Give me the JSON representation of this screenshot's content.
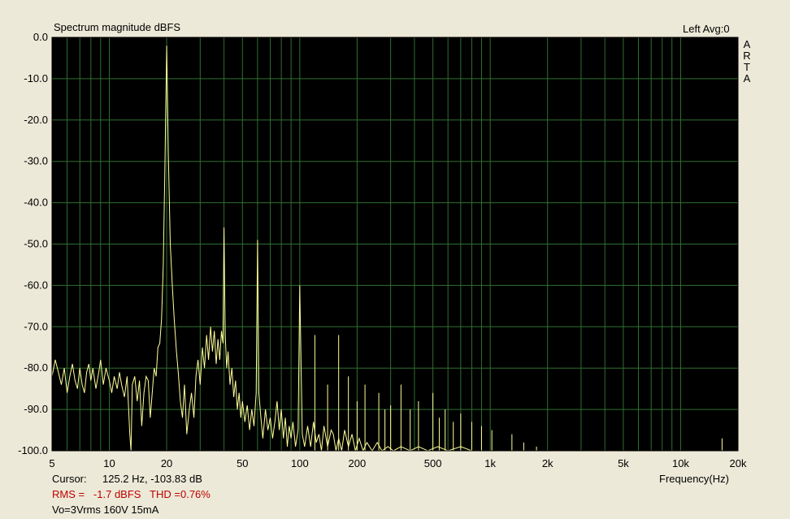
{
  "header": {
    "title": "Spectrum magnitude dBFS",
    "channel_info": "Left  Avg:0",
    "brand_letters": [
      "A",
      "R",
      "T",
      "A"
    ]
  },
  "footer": {
    "cursor_label": "Cursor:",
    "cursor_value": "125.2 Hz, -103.83 dB",
    "rms_text": "RMS =   -1.7 dBFS   THD =0.76%",
    "note": "Vo=3Vrms 160V 15mA"
  },
  "colors": {
    "background": "#ece9d8",
    "plot_bg": "#000000",
    "grid": "#2f6f2f",
    "trace": "#ffff99",
    "rms_text": "#c00000"
  },
  "chart_data": {
    "type": "line",
    "title": "Spectrum magnitude dBFS",
    "xlabel": "Frequency(Hz)",
    "ylabel": "",
    "x_scale": "log",
    "xlim": [
      5,
      20000
    ],
    "ylim": [
      -100,
      0
    ],
    "grid": true,
    "x_ticks": [
      {
        "value": 5,
        "label": "5"
      },
      {
        "value": 10,
        "label": "10"
      },
      {
        "value": 20,
        "label": "20"
      },
      {
        "value": 50,
        "label": "50"
      },
      {
        "value": 100,
        "label": "100"
      },
      {
        "value": 200,
        "label": "200"
      },
      {
        "value": 500,
        "label": "500"
      },
      {
        "value": 1000,
        "label": "1k"
      },
      {
        "value": 2000,
        "label": "2k"
      },
      {
        "value": 5000,
        "label": "5k"
      },
      {
        "value": 10000,
        "label": "10k"
      },
      {
        "value": 20000,
        "label": "20k"
      }
    ],
    "y_ticks": [
      {
        "value": 0,
        "label": "0.0"
      },
      {
        "value": -10,
        "label": "-10.0"
      },
      {
        "value": -20,
        "label": "-20.0"
      },
      {
        "value": -30,
        "label": "-30.0"
      },
      {
        "value": -40,
        "label": "-40.0"
      },
      {
        "value": -50,
        "label": "-50.0"
      },
      {
        "value": -60,
        "label": "-60.0"
      },
      {
        "value": -70,
        "label": "-70.0"
      },
      {
        "value": -80,
        "label": "-80.0"
      },
      {
        "value": -90,
        "label": "-90.0"
      },
      {
        "value": -100,
        "label": "-100.0"
      }
    ],
    "series": [
      {
        "points": [
          [
            5,
            -82
          ],
          [
            5.2,
            -78
          ],
          [
            5.4,
            -81
          ],
          [
            5.6,
            -84
          ],
          [
            5.8,
            -80
          ],
          [
            6.0,
            -86
          ],
          [
            6.2,
            -82
          ],
          [
            6.4,
            -79
          ],
          [
            6.6,
            -83
          ],
          [
            6.8,
            -85
          ],
          [
            7.0,
            -80
          ],
          [
            7.2,
            -84
          ],
          [
            7.4,
            -86
          ],
          [
            7.6,
            -81
          ],
          [
            7.8,
            -79
          ],
          [
            8.0,
            -83
          ],
          [
            8.2,
            -80
          ],
          [
            8.5,
            -85
          ],
          [
            8.8,
            -81
          ],
          [
            9.0,
            -78
          ],
          [
            9.3,
            -84
          ],
          [
            9.6,
            -80
          ],
          [
            10.0,
            -83
          ],
          [
            10.3,
            -86
          ],
          [
            10.6,
            -82
          ],
          [
            11.0,
            -85
          ],
          [
            11.3,
            -81
          ],
          [
            11.6,
            -84
          ],
          [
            12.0,
            -87
          ],
          [
            12.4,
            -82
          ],
          [
            12.8,
            -96
          ],
          [
            13.0,
            -100
          ],
          [
            13.2,
            -84
          ],
          [
            13.6,
            -82
          ],
          [
            14.0,
            -88
          ],
          [
            14.4,
            -83
          ],
          [
            14.8,
            -94
          ],
          [
            15.2,
            -86
          ],
          [
            15.6,
            -82
          ],
          [
            16.0,
            -83
          ],
          [
            16.4,
            -92
          ],
          [
            16.8,
            -86
          ],
          [
            17.2,
            -80
          ],
          [
            17.6,
            -82
          ],
          [
            18.0,
            -75
          ],
          [
            18.4,
            -74
          ],
          [
            18.8,
            -68
          ],
          [
            19.2,
            -55
          ],
          [
            19.6,
            -30
          ],
          [
            20.0,
            -2
          ],
          [
            20.4,
            -28
          ],
          [
            20.9,
            -50
          ],
          [
            21.4,
            -60
          ],
          [
            21.9,
            -68
          ],
          [
            22.5,
            -76
          ],
          [
            23.0,
            -81
          ],
          [
            23.6,
            -88
          ],
          [
            24.2,
            -92
          ],
          [
            24.8,
            -84
          ],
          [
            25.5,
            -96
          ],
          [
            26.3,
            -90
          ],
          [
            27.0,
            -86
          ],
          [
            27.8,
            -92
          ],
          [
            28.5,
            -82
          ],
          [
            29.2,
            -78
          ],
          [
            30.0,
            -84
          ],
          [
            30.8,
            -75
          ],
          [
            31.6,
            -80
          ],
          [
            32.4,
            -72
          ],
          [
            33.2,
            -78
          ],
          [
            34.0,
            -70
          ],
          [
            34.8,
            -76
          ],
          [
            35.6,
            -71
          ],
          [
            36.4,
            -79
          ],
          [
            37.2,
            -73
          ],
          [
            38.0,
            -78
          ],
          [
            38.8,
            -71
          ],
          [
            39.5,
            -74
          ],
          [
            40.0,
            -46
          ],
          [
            40.6,
            -72
          ],
          [
            41.3,
            -80
          ],
          [
            42.0,
            -76
          ],
          [
            43.0,
            -84
          ],
          [
            44.0,
            -80
          ],
          [
            45.0,
            -87
          ],
          [
            46.0,
            -83
          ],
          [
            47.0,
            -90
          ],
          [
            48.0,
            -86
          ],
          [
            49.0,
            -92
          ],
          [
            50.0,
            -88
          ],
          [
            51.5,
            -93
          ],
          [
            53.0,
            -89
          ],
          [
            54.5,
            -95
          ],
          [
            56.0,
            -90
          ],
          [
            57.5,
            -94
          ],
          [
            59.0,
            -86
          ],
          [
            60.0,
            -49
          ],
          [
            61.0,
            -86
          ],
          [
            62.5,
            -92
          ],
          [
            64.0,
            -97
          ],
          [
            66.0,
            -90
          ],
          [
            68.0,
            -95
          ],
          [
            70.0,
            -92
          ],
          [
            72.0,
            -97
          ],
          [
            74.0,
            -93
          ],
          [
            76.0,
            -88
          ],
          [
            78.0,
            -95
          ],
          [
            80.0,
            -90
          ],
          [
            82.0,
            -97
          ],
          [
            84.0,
            -92
          ],
          [
            86.0,
            -99
          ],
          [
            88.0,
            -94
          ],
          [
            90.0,
            -97
          ],
          [
            92.0,
            -93
          ],
          [
            95.0,
            -99
          ],
          [
            98.0,
            -95
          ],
          [
            100.0,
            -60
          ],
          [
            103.0,
            -96
          ],
          [
            106.0,
            -99
          ],
          [
            110.0,
            -94
          ],
          [
            114.0,
            -99
          ],
          [
            118.0,
            -93
          ],
          [
            122.0,
            -98
          ],
          [
            126.0,
            -96
          ],
          [
            130.0,
            -100
          ],
          [
            134.0,
            -94
          ],
          [
            140.0,
            -99
          ],
          [
            146.0,
            -95
          ],
          [
            150.0,
            -96
          ],
          [
            155.0,
            -100
          ],
          [
            160.0,
            -97
          ],
          [
            166.0,
            -100
          ],
          [
            172.0,
            -95
          ],
          [
            180.0,
            -99
          ],
          [
            188.0,
            -96
          ],
          [
            196.0,
            -100
          ],
          [
            205.0,
            -97
          ],
          [
            215.0,
            -100
          ],
          [
            225.0,
            -98
          ],
          [
            240.0,
            -100
          ],
          [
            255.0,
            -98
          ],
          [
            270.0,
            -100
          ],
          [
            290.0,
            -99
          ],
          [
            310.0,
            -100
          ],
          [
            340.0,
            -99
          ],
          [
            380.0,
            -100
          ],
          [
            420.0,
            -99
          ],
          [
            470.0,
            -100
          ],
          [
            530.0,
            -99
          ],
          [
            600.0,
            -100
          ],
          [
            700.0,
            -99
          ],
          [
            800.0,
            -100
          ],
          [
            1000.0,
            -100
          ],
          [
            20000,
            -100
          ]
        ]
      }
    ],
    "spikes": [
      {
        "x": 120,
        "y": -72
      },
      {
        "x": 140,
        "y": -84
      },
      {
        "x": 160,
        "y": -72
      },
      {
        "x": 180,
        "y": -82
      },
      {
        "x": 200,
        "y": -88
      },
      {
        "x": 220,
        "y": -84
      },
      {
        "x": 260,
        "y": -86
      },
      {
        "x": 280,
        "y": -90
      },
      {
        "x": 300,
        "y": -89
      },
      {
        "x": 340,
        "y": -84
      },
      {
        "x": 380,
        "y": -90
      },
      {
        "x": 420,
        "y": -88
      },
      {
        "x": 500,
        "y": -86
      },
      {
        "x": 540,
        "y": -92
      },
      {
        "x": 580,
        "y": -90
      },
      {
        "x": 640,
        "y": -93
      },
      {
        "x": 700,
        "y": -91
      },
      {
        "x": 800,
        "y": -93
      },
      {
        "x": 900,
        "y": -94
      },
      {
        "x": 1020,
        "y": -95
      },
      {
        "x": 1300,
        "y": -96
      },
      {
        "x": 1500,
        "y": -98
      },
      {
        "x": 1750,
        "y": -99
      },
      {
        "x": 16500,
        "y": -97
      }
    ]
  }
}
